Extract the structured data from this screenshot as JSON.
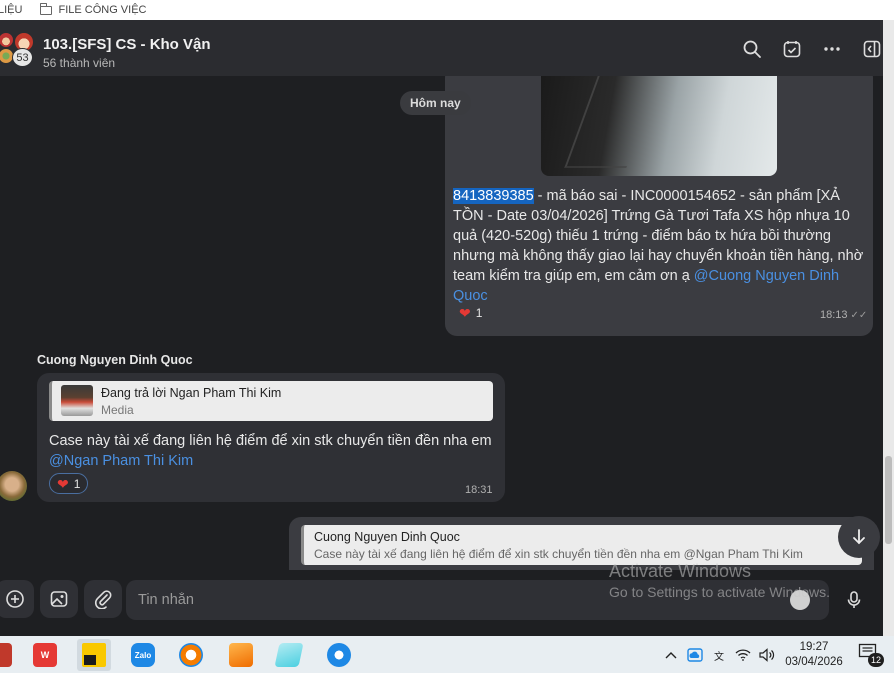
{
  "bookmarks": {
    "left_fragment": "LIỆU",
    "folder": "FILE CÔNG VIỆC"
  },
  "header": {
    "title": "103.[SFS] CS - Kho Vận",
    "subtitle": "56 thành viên",
    "avatar_count": "53",
    "icons": [
      "search-icon",
      "checklist-icon",
      "more-icon",
      "toggle-panel-icon"
    ]
  },
  "messages": {
    "date_chip": "Hôm nay",
    "outgoing_1": {
      "highlight": "8413839385",
      "text": " - mã báo sai - INC0000154652  - sản phẩm [XẢ TỒN - Date 03/04/2026] Trứng Gà Tươi Tafa XS hộp nhựa 10 quả (420-520g) thiếu 1 trứng - điểm báo tx hứa bồi thường nhưng mà không thấy giao lại hay chuyển khoản tiền hàng, nhờ team kiểm tra giúp em, em cảm ơn ạ ",
      "mention": "@Cuong Nguyen Dinh Quoc",
      "reaction_count": "1",
      "time": "18:13"
    },
    "incoming_1": {
      "sender": "Cuong Nguyen Dinh Quoc",
      "reply_title": "Đang trả lời Ngan Pham Thi Kim",
      "reply_subtitle": "Media",
      "text": "Case này tài xế đang liên hệ điểm để xin stk chuyển tiền đền nha em ",
      "mention": "@Ngan Pham Thi Kim",
      "reaction_count": "1",
      "time": "18:31"
    },
    "outgoing_2": {
      "reply_title": "Cuong Nguyen Dinh Quoc",
      "reply_subtitle": "Case này tài xế đang liên hệ điểm để xin stk chuyển tiền đền nha em @Ngan Pham Thi Kim"
    }
  },
  "composer": {
    "placeholder": "Tin nhắn"
  },
  "watermark": {
    "line1": "Activate Windows",
    "line2": "Go to Settings to activate Windows."
  },
  "taskbar": {
    "apps": [
      "wps-office",
      "sticky-notes",
      "zalo",
      "chrome-like",
      "sublime-like",
      "notes-like",
      "telegram-like"
    ],
    "zalo_label": "Zalo",
    "time": "19:27",
    "date": "03/04/2026",
    "notification_count": "12"
  }
}
